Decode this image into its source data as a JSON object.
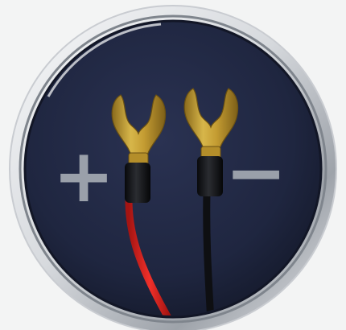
{
  "icon": {
    "name": "spade-terminal-connector-icon",
    "symbols": {
      "positive": "+",
      "negative": "−"
    },
    "colors": {
      "page_background": "#f3f4f4",
      "bezel_light": "#eef0f2",
      "bezel_dark": "#8e939a",
      "face": "#1f2640",
      "face_edge": "#161b2e",
      "symbol": "#9aa0aa",
      "terminal_gold": "#c9a33a",
      "terminal_gold_dark": "#8a6a1c",
      "sleeve": "#15161a",
      "wire_red": "#e5211e",
      "wire_black": "#0e0f12"
    }
  }
}
